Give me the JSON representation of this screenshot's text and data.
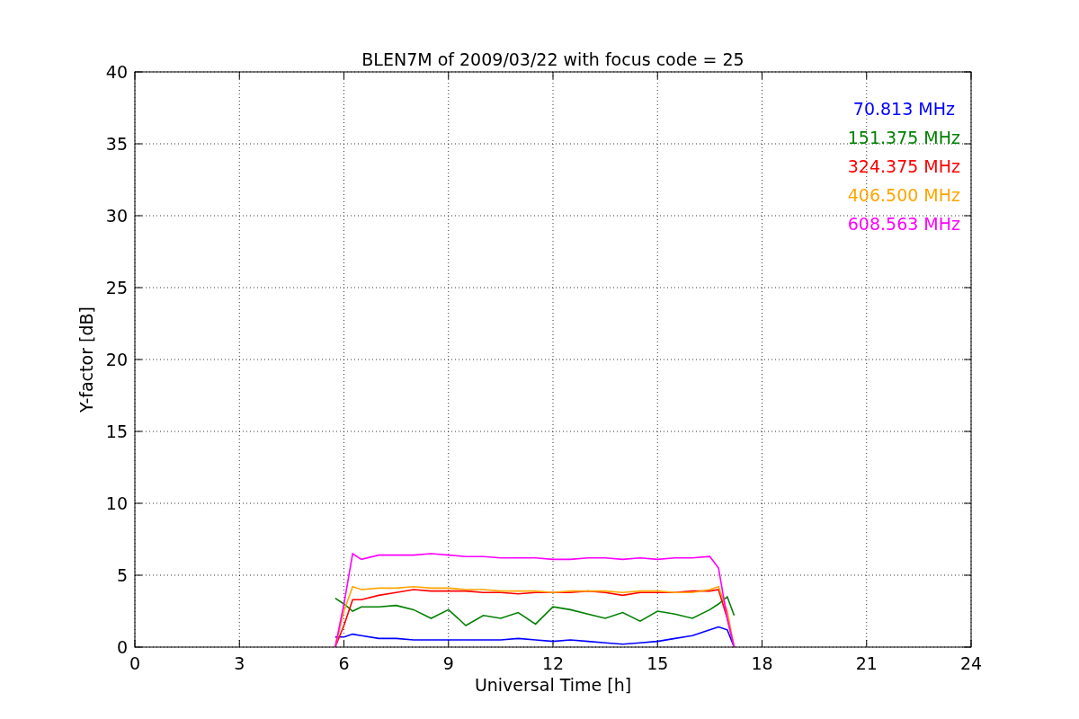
{
  "chart_data": {
    "type": "line",
    "title": "BLEN7M of 2009/03/22 with focus code = 25",
    "xlabel": "Universal Time [h]",
    "ylabel": "Y-factor [dB]",
    "x": [
      5.75,
      6.0,
      6.25,
      6.5,
      7,
      7.5,
      8,
      8.5,
      9,
      9.5,
      10,
      10.5,
      11,
      11.5,
      12,
      12.5,
      13,
      13.5,
      14,
      14.5,
      15,
      15.5,
      16,
      16.5,
      16.75,
      17,
      17.2
    ],
    "series": [
      {
        "name": "70.813 MHz",
        "color": "#0000ff",
        "values": [
          0.7,
          0.7,
          0.9,
          0.8,
          0.6,
          0.6,
          0.5,
          0.5,
          0.5,
          0.5,
          0.5,
          0.5,
          0.6,
          0.5,
          0.4,
          0.5,
          0.4,
          0.3,
          0.2,
          0.3,
          0.4,
          0.6,
          0.8,
          1.2,
          1.4,
          1.2,
          0
        ]
      },
      {
        "name": "151.375 MHz",
        "color": "#008000",
        "values": [
          3.4,
          3.0,
          2.5,
          2.8,
          2.8,
          2.9,
          2.6,
          2.0,
          2.6,
          1.5,
          2.2,
          2.0,
          2.4,
          1.6,
          2.8,
          2.6,
          2.3,
          2.0,
          2.4,
          1.8,
          2.5,
          2.3,
          2.0,
          2.6,
          3.0,
          3.5,
          2.2
        ]
      },
      {
        "name": "324.375 MHz",
        "color": "#ff0000",
        "values": [
          0,
          1.5,
          3.3,
          3.3,
          3.6,
          3.8,
          4.0,
          3.9,
          3.9,
          3.9,
          3.8,
          3.8,
          3.7,
          3.8,
          3.8,
          3.8,
          3.9,
          3.8,
          3.6,
          3.8,
          3.8,
          3.8,
          3.9,
          3.9,
          4.0,
          2,
          0
        ]
      },
      {
        "name": "406.500 MHz",
        "color": "#ffa500",
        "values": [
          0,
          2.5,
          4.2,
          4.0,
          4.1,
          4.1,
          4.2,
          4.1,
          4.1,
          4.0,
          4.0,
          3.9,
          3.9,
          3.9,
          3.8,
          3.9,
          3.9,
          3.9,
          3.8,
          3.9,
          3.9,
          3.8,
          3.8,
          4.0,
          4.2,
          2.5,
          0
        ]
      },
      {
        "name": "608.563 MHz",
        "color": "#ff00ff",
        "values": [
          0,
          3,
          6.5,
          6.1,
          6.4,
          6.4,
          6.4,
          6.5,
          6.4,
          6.3,
          6.3,
          6.2,
          6.2,
          6.2,
          6.1,
          6.1,
          6.2,
          6.2,
          6.1,
          6.2,
          6.1,
          6.2,
          6.2,
          6.3,
          5.5,
          2,
          0
        ]
      }
    ],
    "grid": true,
    "xlim": [
      0,
      24
    ],
    "ylim": [
      0,
      40
    ],
    "xticks": [
      0,
      3,
      6,
      9,
      12,
      15,
      18,
      21,
      24
    ],
    "yticks": [
      0,
      5,
      10,
      15,
      20,
      25,
      30,
      35,
      40
    ]
  }
}
